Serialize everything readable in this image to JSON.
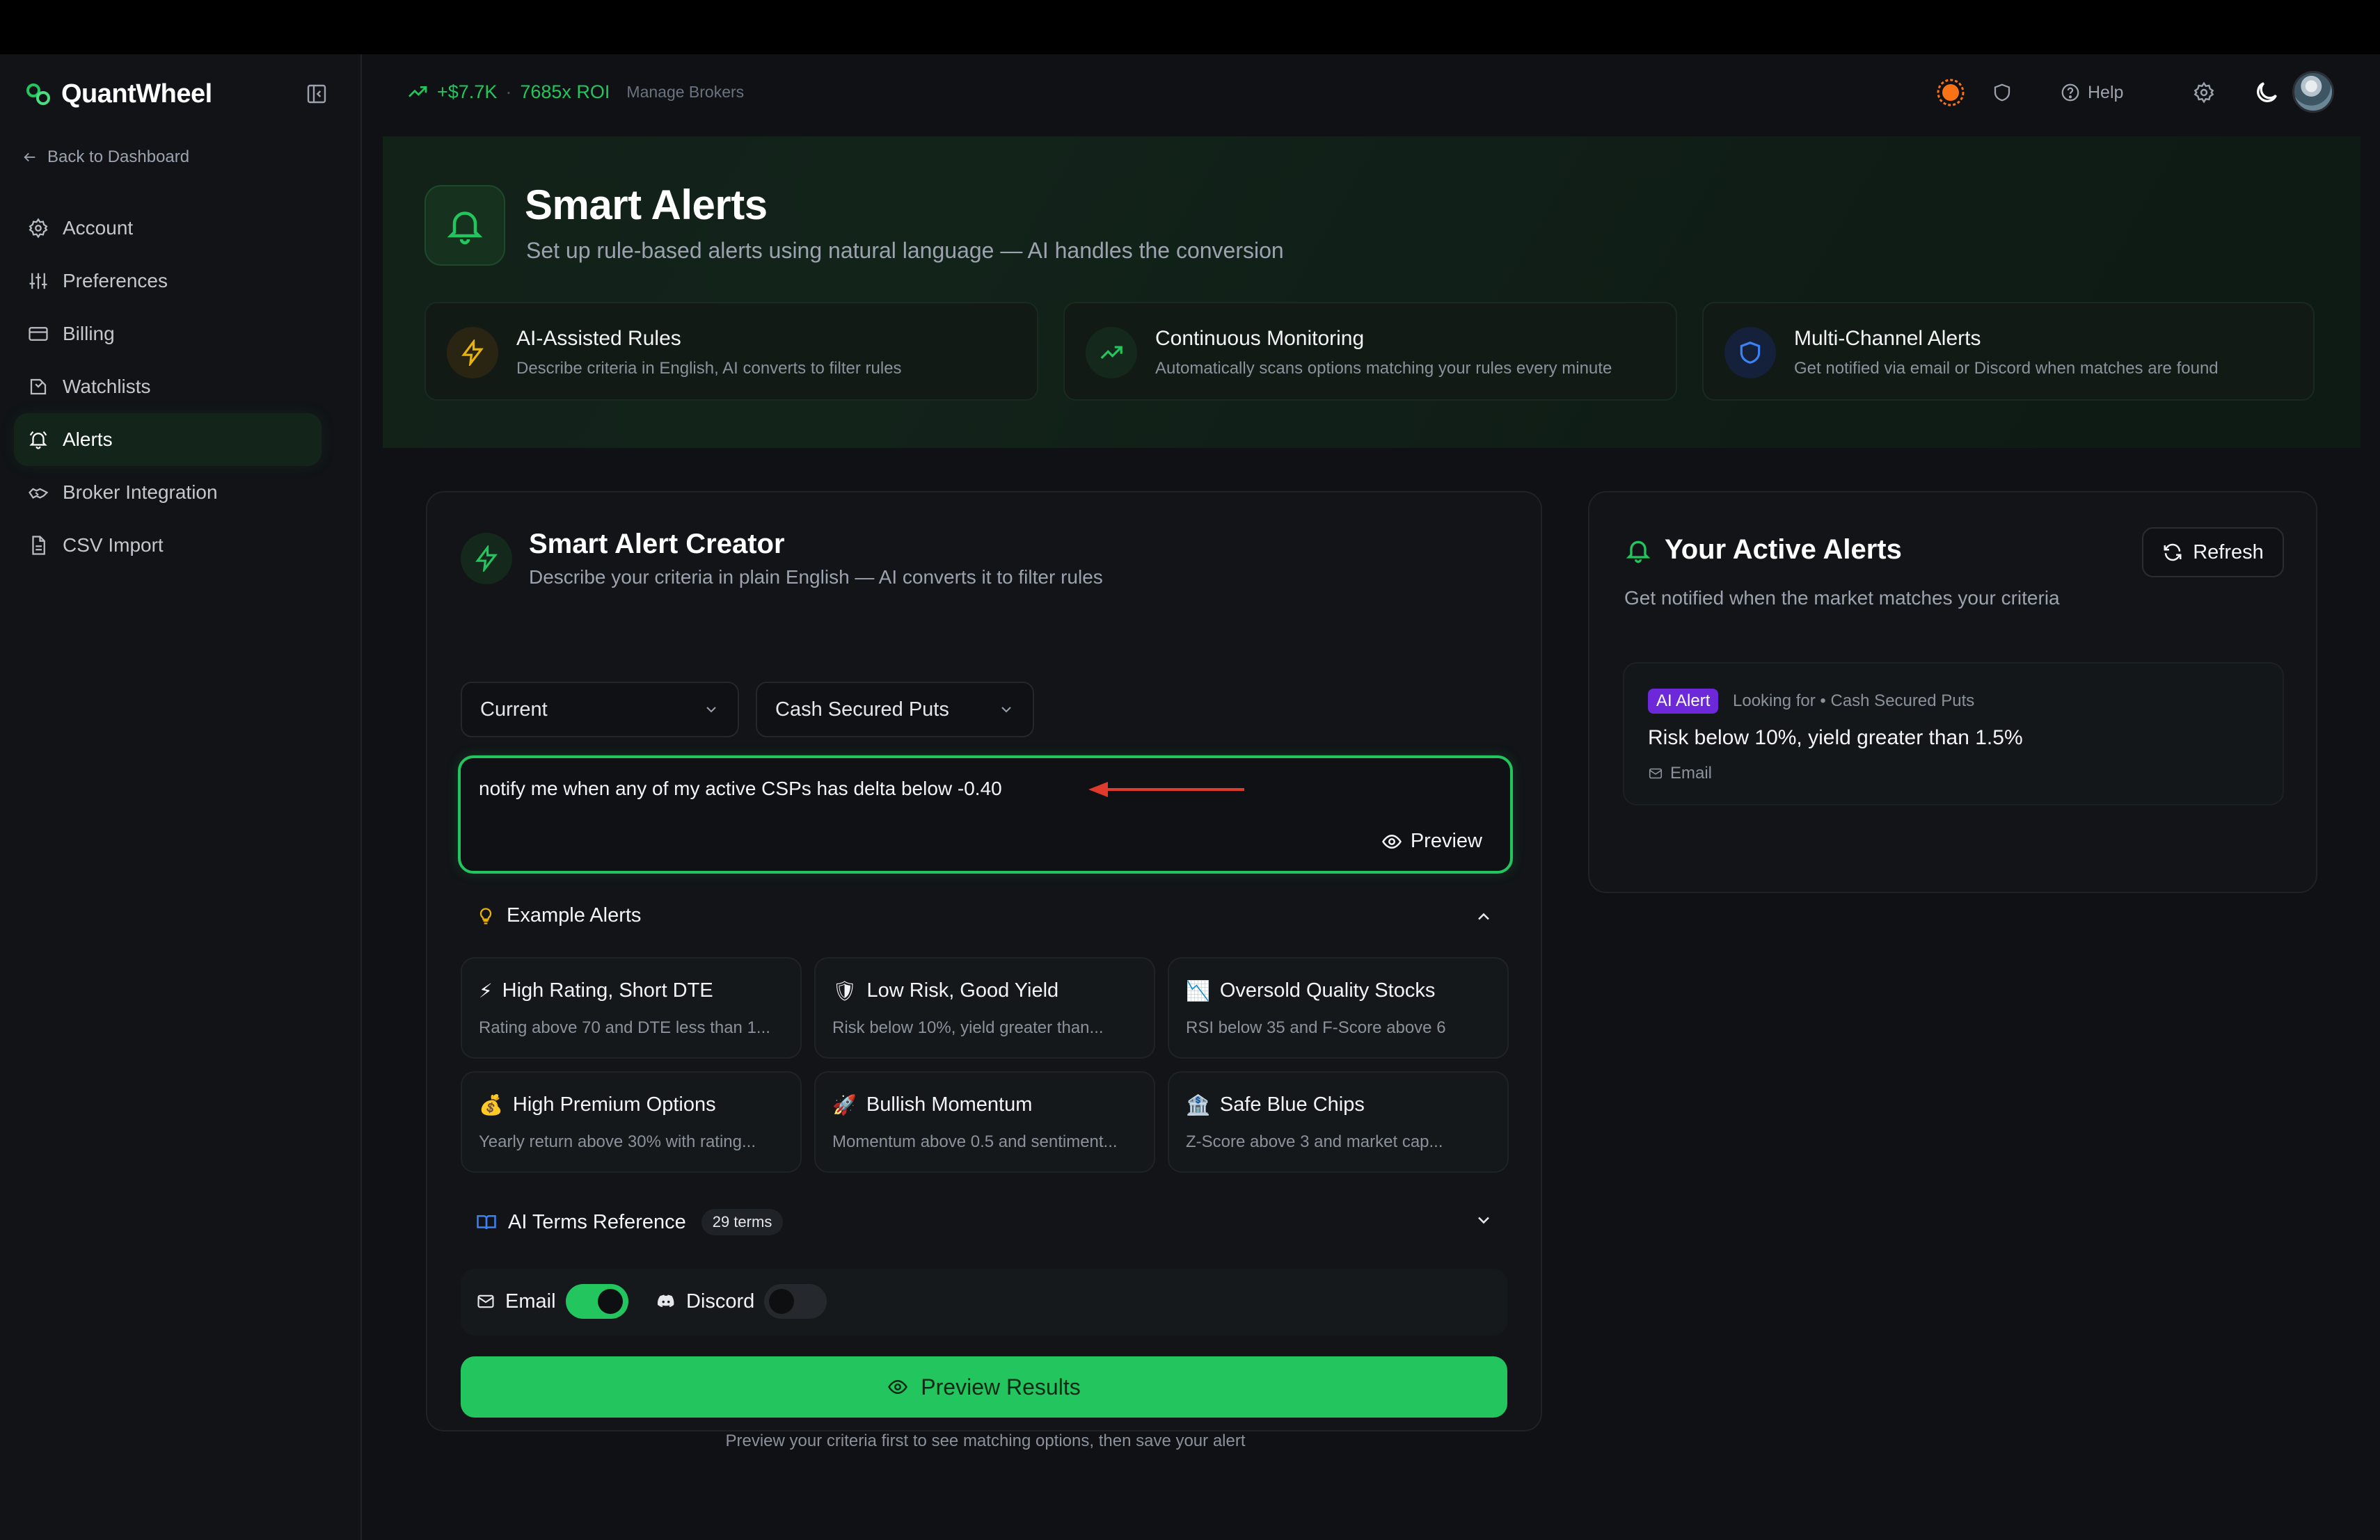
{
  "brand": {
    "name": "QuantWheel"
  },
  "sidebar": {
    "back_label": "Back to Dashboard",
    "items": [
      {
        "label": "Account",
        "icon": "gear-icon"
      },
      {
        "label": "Preferences",
        "icon": "sliders-icon"
      },
      {
        "label": "Billing",
        "icon": "credit-card-icon"
      },
      {
        "label": "Watchlists",
        "icon": "bookmark-icon"
      },
      {
        "label": "Alerts",
        "icon": "bell-icon",
        "active": true
      },
      {
        "label": "Broker Integration",
        "icon": "handshake-icon"
      },
      {
        "label": "CSV Import",
        "icon": "file-icon"
      }
    ]
  },
  "topbar": {
    "gain": "+$7.7K",
    "separator": "·",
    "roi": "7685x ROI",
    "manage_brokers": "Manage Brokers",
    "help_label": "Help"
  },
  "hero": {
    "title": "Smart Alerts",
    "subtitle": "Set up rule-based alerts using natural language — AI handles the conversion",
    "features": [
      {
        "title": "AI-Assisted Rules",
        "desc": "Describe criteria in English, AI converts to filter rules",
        "icon": "lightning-icon"
      },
      {
        "title": "Continuous Monitoring",
        "desc": "Automatically scans options matching your rules every minute",
        "icon": "trending-up-icon"
      },
      {
        "title": "Multi-Channel Alerts",
        "desc": "Get notified via email or Discord when matches are found",
        "icon": "shield-icon"
      }
    ]
  },
  "creator": {
    "title": "Smart Alert Creator",
    "subtitle": "Describe your criteria in plain English — AI converts it to filter rules",
    "select_period": "Current",
    "select_strategy": "Cash Secured Puts",
    "input_value": "notify me when any of my active CSPs has delta below -0.40",
    "preview_label": "Preview",
    "examples_title": "Example Alerts",
    "examples": [
      {
        "emoji": "⚡",
        "title": "High Rating, Short DTE",
        "desc": "Rating above 70 and DTE less than 1..."
      },
      {
        "emoji": "🛡",
        "title": "Low Risk, Good Yield",
        "desc": "Risk below 10%, yield greater than..."
      },
      {
        "emoji": "📉",
        "title": "Oversold Quality Stocks",
        "desc": "RSI below 35 and F-Score above 6"
      },
      {
        "emoji": "💰",
        "title": "High Premium Options",
        "desc": "Yearly return above 30% with rating..."
      },
      {
        "emoji": "🚀",
        "title": "Bullish Momentum",
        "desc": "Momentum above 0.5 and sentiment..."
      },
      {
        "emoji": "🏦",
        "title": "Safe Blue Chips",
        "desc": "Z-Score above 3 and market cap..."
      }
    ],
    "terms_label": "AI Terms Reference",
    "terms_count": "29 terms",
    "email_label": "Email",
    "email_on": true,
    "discord_label": "Discord",
    "discord_on": false,
    "primary_label": "Preview Results",
    "hint": "Preview your criteria first to see matching options, then save your alert"
  },
  "active": {
    "title": "Your Active Alerts",
    "subtitle": "Get notified when the market matches your criteria",
    "refresh_label": "Refresh",
    "alert": {
      "badge": "AI Alert",
      "meta": "Looking for • Cash Secured Puts",
      "rule": "Risk below 10%, yield greater than 1.5%",
      "channel": "Email"
    }
  },
  "colors": {
    "accent": "#22c55e",
    "background": "#0f1114",
    "badge": "#6d28d9",
    "warning": "#f97316"
  }
}
